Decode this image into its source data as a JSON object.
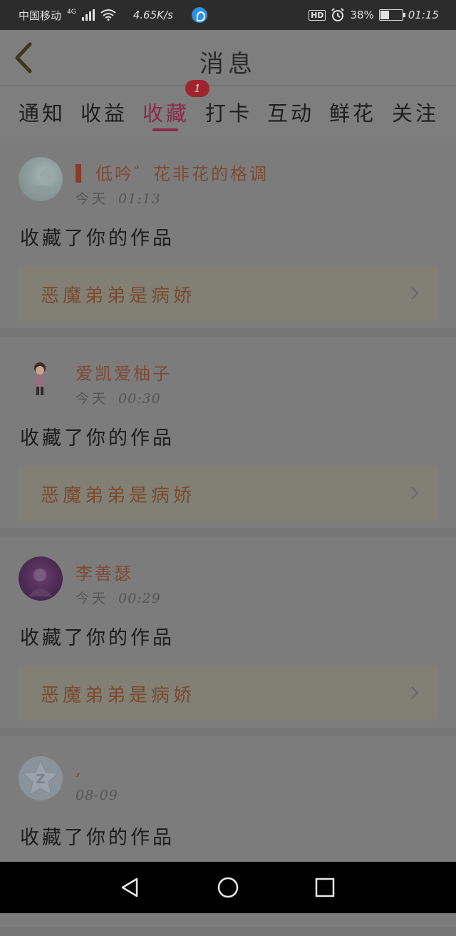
{
  "status_bar": {
    "carrier": "中国移动",
    "network_type": "4G",
    "net_speed": "4.65K/s",
    "hd_label": "HD",
    "battery": "38%",
    "battery_level": 0.38,
    "time": "01:15",
    "icons": [
      "signal-icon",
      "wifi-icon",
      "app-notification-icon",
      "alarm-icon",
      "battery-icon"
    ]
  },
  "header": {
    "title": "消息",
    "back_icon": "back-chevron-icon"
  },
  "tabs": {
    "items": [
      {
        "label": "通知"
      },
      {
        "label": "收益"
      },
      {
        "label": "收藏",
        "active": true,
        "badge": "1"
      },
      {
        "label": "打卡"
      },
      {
        "label": "互动"
      },
      {
        "label": "鲜花"
      },
      {
        "label": "关注"
      }
    ]
  },
  "feed": {
    "items": [
      {
        "username": "低吟゛花非花的格调",
        "date": "今天",
        "time": "01:13",
        "action": "收藏了你的作品",
        "work_title": "恶魔弟弟是病娇"
      },
      {
        "username": "爱凯爱柚子",
        "date": "今天",
        "time": "00:30",
        "action": "收藏了你的作品",
        "work_title": "恶魔弟弟是病娇"
      },
      {
        "username": "李善瑟",
        "date": "今天",
        "time": "00:29",
        "action": "收藏了你的作品",
        "work_title": "恶魔弟弟是病娇"
      },
      {
        "username": ",",
        "date": "",
        "time": "08-09",
        "action": "收藏了你的作品",
        "work_title": ""
      }
    ]
  },
  "colors": {
    "accent": "#8a2a4a",
    "badge": "#a0242b",
    "username": "#7d4a35"
  },
  "navbar": {
    "icons": [
      "back-triangle-icon",
      "home-circle-icon",
      "recents-square-icon"
    ]
  }
}
